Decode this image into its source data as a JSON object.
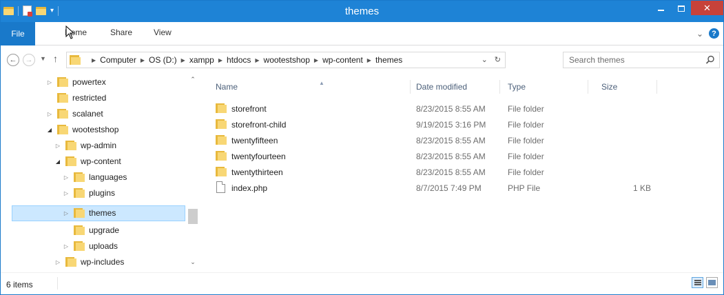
{
  "window": {
    "title": "themes"
  },
  "ribbon": {
    "tabs": [
      "File",
      "Home",
      "Share",
      "View"
    ]
  },
  "address": {
    "breadcrumbs": [
      "Computer",
      "OS (D:)",
      "xampp",
      "htdocs",
      "wootestshop",
      "wp-content",
      "themes"
    ]
  },
  "search": {
    "placeholder": "Search themes"
  },
  "tree": {
    "items": [
      {
        "label": "powertex",
        "twisty": "▷"
      },
      {
        "label": "restricted",
        "twisty": ""
      },
      {
        "label": "scalanet",
        "twisty": "▷"
      },
      {
        "label": "wootestshop",
        "twisty": "◢"
      },
      {
        "label": "wp-admin",
        "twisty": "▷"
      },
      {
        "label": "wp-content",
        "twisty": "◢"
      },
      {
        "label": "languages",
        "twisty": "▷"
      },
      {
        "label": "plugins",
        "twisty": "▷"
      },
      {
        "label": "themes",
        "twisty": "▷"
      },
      {
        "label": "upgrade",
        "twisty": ""
      },
      {
        "label": "uploads",
        "twisty": "▷"
      },
      {
        "label": "wp-includes",
        "twisty": "▷"
      }
    ]
  },
  "columns": {
    "name": "Name",
    "date_modified": "Date modified",
    "type": "Type",
    "size": "Size"
  },
  "files": [
    {
      "name": "storefront",
      "date": "8/23/2015 8:55 AM",
      "type": "File folder",
      "size": "",
      "kind": "folder"
    },
    {
      "name": "storefront-child",
      "date": "9/19/2015 3:16 PM",
      "type": "File folder",
      "size": "",
      "kind": "folder"
    },
    {
      "name": "twentyfifteen",
      "date": "8/23/2015 8:55 AM",
      "type": "File folder",
      "size": "",
      "kind": "folder"
    },
    {
      "name": "twentyfourteen",
      "date": "8/23/2015 8:55 AM",
      "type": "File folder",
      "size": "",
      "kind": "folder"
    },
    {
      "name": "twentythirteen",
      "date": "8/23/2015 8:55 AM",
      "type": "File folder",
      "size": "",
      "kind": "folder"
    },
    {
      "name": "index.php",
      "date": "8/7/2015 7:49 PM",
      "type": "PHP File",
      "size": "1 KB",
      "kind": "file"
    }
  ],
  "status": {
    "item_count": "6 items"
  },
  "colors": {
    "titlebar": "#1e83d6",
    "file_tab": "#1979ca",
    "close_button": "#c7423a",
    "selection": "#cce8ff",
    "folder": "#f8d775"
  }
}
